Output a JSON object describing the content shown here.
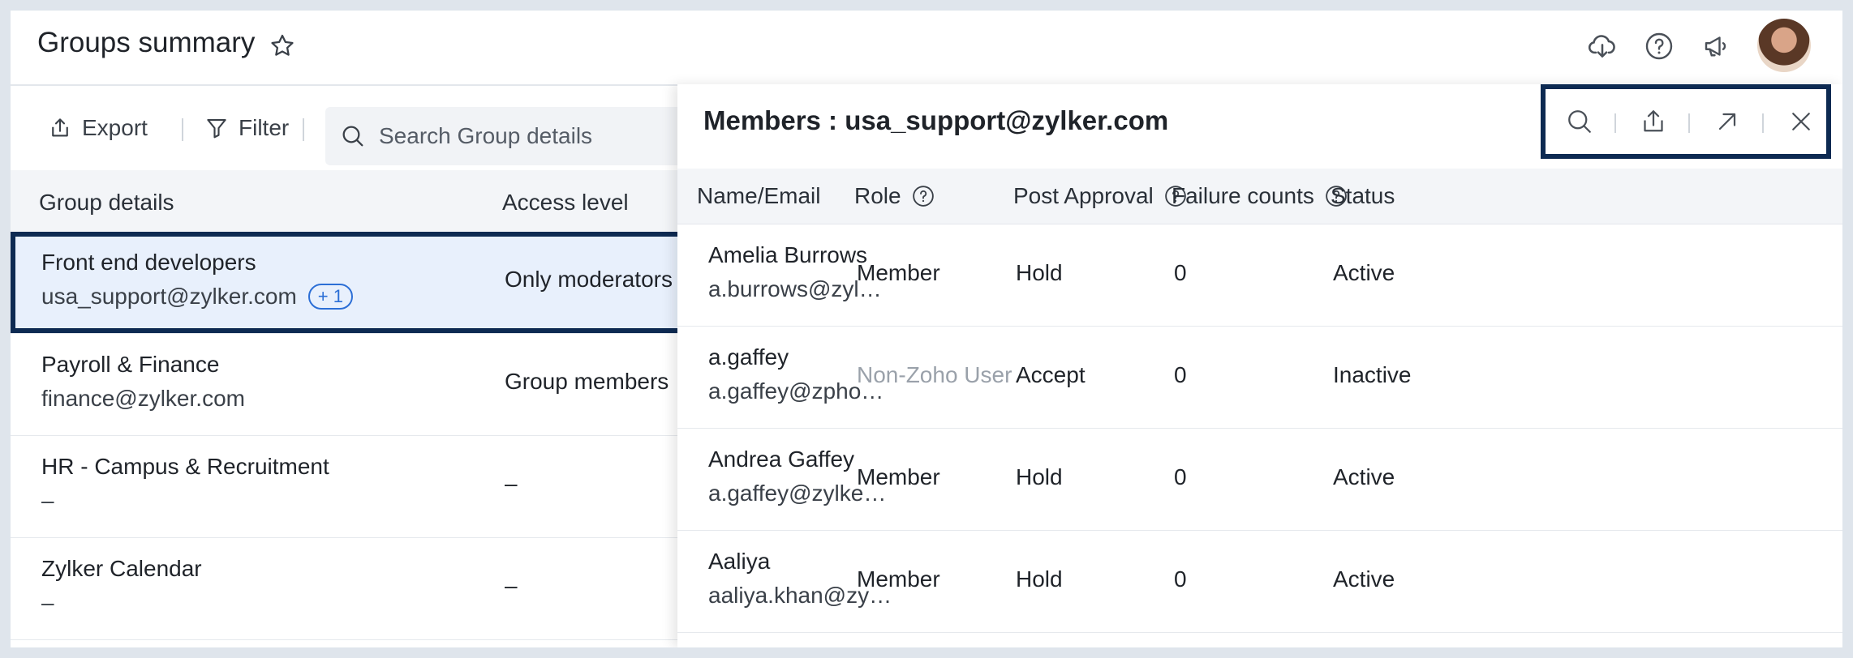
{
  "header": {
    "title": "Groups summary",
    "icons": [
      "star-icon",
      "cloud-download-icon",
      "help-icon",
      "announcement-icon",
      "avatar"
    ]
  },
  "toolbar": {
    "export_label": "Export",
    "filter_label": "Filter",
    "search_placeholder": "Search Group details"
  },
  "groups": {
    "columns": [
      "Group details",
      "Access level"
    ],
    "rows": [
      {
        "name": "Front end developers",
        "email": "usa_support@zylker.com",
        "badge": "+ 1",
        "access": "Only moderators",
        "selected": true
      },
      {
        "name": "Payroll & Finance",
        "email": "finance@zylker.com",
        "access": "Group members"
      },
      {
        "name": "HR - Campus & Recruitment",
        "email": "–",
        "access": "–"
      },
      {
        "name": "Zylker Calendar",
        "email": "–",
        "access": "–"
      }
    ]
  },
  "members_panel": {
    "title": "Members : usa_support@zylker.com",
    "actions": [
      "search-icon",
      "share-icon",
      "expand-icon",
      "close-icon"
    ],
    "columns": {
      "name": "Name/Email",
      "role": "Role",
      "post_approval": "Post Approval",
      "failure_counts": "Failure counts",
      "status": "Status"
    },
    "rows": [
      {
        "name": "Amelia Burrows",
        "email": "a.burrows@zyl…",
        "role": "Member",
        "post_approval": "Hold",
        "failure_counts": "0",
        "status": "Active"
      },
      {
        "name": "a.gaffey",
        "email": "a.gaffey@zpho…",
        "role": "Non-Zoho User",
        "post_approval": "Accept",
        "failure_counts": "0",
        "status": "Inactive"
      },
      {
        "name": "Andrea Gaffey",
        "email": "a.gaffey@zylke…",
        "role": "Member",
        "post_approval": "Hold",
        "failure_counts": "0",
        "status": "Active"
      },
      {
        "name": "Aaliya",
        "email": "aaliya.khan@zy…",
        "role": "Member",
        "post_approval": "Hold",
        "failure_counts": "0",
        "status": "Active"
      }
    ]
  },
  "colors": {
    "highlight_border": "#0d2a52",
    "badge": "#2c6fd6",
    "selected_row": "#e8f0fc",
    "header_bg": "#f3f5f8"
  }
}
